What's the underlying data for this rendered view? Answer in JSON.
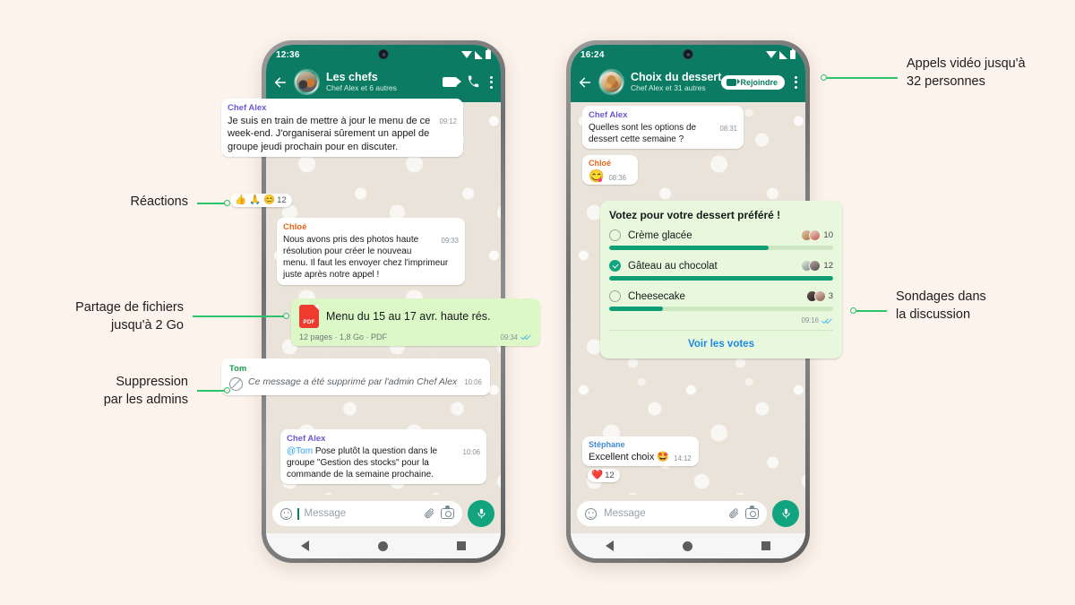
{
  "annotations": [
    {
      "id": "reactions",
      "text": "Réactions"
    },
    {
      "id": "filesharing",
      "text": "Partage de fichiers\njusqu'à 2 Go"
    },
    {
      "id": "admindelete",
      "text": "Suppression\npar les admins"
    },
    {
      "id": "videocalls",
      "text": "Appels vidéo jusqu'à\n32 personnes"
    },
    {
      "id": "polls",
      "text": "Sondages dans\nla discussion"
    }
  ],
  "annotation_lines": {
    "reactions_l1": "Réactions",
    "filesharing_l1": "Partage de fichiers",
    "filesharing_l2": "jusqu'à 2 Go",
    "admindelete_l1": "Suppression",
    "admindelete_l2": "par les admins",
    "videocalls_l1": "Appels vidéo jusqu'à",
    "videocalls_l2": "32 personnes",
    "polls_l1": "Sondages dans",
    "polls_l2": "la discussion"
  },
  "colors": {
    "page_background": "#FCF3EC",
    "whatsapp_green": "#0B7C63",
    "accent_green": "#12A37F",
    "leader_line": "#2CC36B",
    "outgoing_bubble": "#DCF8C6",
    "poll_bubble": "#E8F8DC",
    "link_blue": "#1E88E5",
    "mention_blue": "#2EA2F5",
    "pdf_red": "#EE3B2F"
  },
  "phone_left": {
    "status": {
      "clock": "12:36",
      "icons": [
        "wifi-icon",
        "signal-icon",
        "battery-icon"
      ]
    },
    "appbar": {
      "back_icon": "back-arrow-icon",
      "avatar": "group-avatar",
      "title": "Les chefs",
      "subtitle": "Chef Alex et 6 autres",
      "actions": [
        "video-call-icon",
        "voice-call-icon",
        "overflow-menu-icon"
      ]
    },
    "messages": [
      {
        "sender": "Chef Alex",
        "sender_color": "#6B57D6",
        "text": "Je suis en train de mettre à jour le menu de ce week-end. J'organiserai sûrement un appel de groupe jeudi prochain pour en discuter.",
        "time": "09:12",
        "reaction": {
          "emojis": "👍 🙏 😊",
          "count": "12"
        }
      },
      {
        "sender": "Chloé",
        "sender_color": "#E8651B",
        "text": "Nous avons pris des photos haute résolution pour créer le nouveau menu. Il faut les envoyer chez l'imprimeur juste après notre appel !",
        "time": "09:33"
      },
      {
        "type": "file",
        "file_icon": "pdf-file-icon",
        "file_badge": "PDF",
        "file_name": "Menu du 15 au 17 avr. haute rés.",
        "file_meta": "12 pages · 1,8 Go · PDF",
        "time": "09:34",
        "status_icon": "double-check-icon"
      },
      {
        "sender": "Tom",
        "sender_color": "#1A9E4B",
        "type": "deleted",
        "icon": "blocked-icon",
        "text": "Ce message a été supprimé par l'admin Chef Alex",
        "time": "10:06"
      },
      {
        "sender": "Chef Alex",
        "sender_color": "#6B57D6",
        "mention": "@Tom",
        "text": " Pose plutôt la question dans le groupe \"Gestion des stocks\" pour la commande de la semaine prochaine.",
        "time": "10:06"
      }
    ],
    "input": {
      "emoji_icon": "smiley-icon",
      "placeholder": "Message",
      "attach_icon": "paperclip-icon",
      "camera_icon": "camera-icon",
      "mic_icon": "microphone-icon"
    },
    "navbar": [
      "back-nav-icon",
      "home-nav-icon",
      "recents-nav-icon"
    ]
  },
  "phone_right": {
    "status": {
      "clock": "16:24",
      "icons": [
        "wifi-icon",
        "signal-icon",
        "battery-icon"
      ]
    },
    "appbar": {
      "back_icon": "back-arrow-icon",
      "avatar": "group-avatar",
      "title": "Choix du dessert",
      "subtitle": "Chef Alex et 31 autres",
      "join_button": "Rejoindre",
      "join_icon": "video-call-icon",
      "actions": [
        "overflow-menu-icon"
      ]
    },
    "messages": [
      {
        "sender": "Chef Alex",
        "sender_color": "#6B57D6",
        "text": "Quelles sont les options de dessert cette semaine ?",
        "time": "08:31"
      },
      {
        "sender": "Chloé",
        "sender_color": "#E8651B",
        "emoji": "😋",
        "time": "08:36"
      },
      {
        "sender": "Stéphane",
        "sender_color": "#3F8CD4",
        "text": "Excellent choix 🤩",
        "time": "14:12",
        "reaction": {
          "emojis": "❤️",
          "count": "12"
        }
      }
    ],
    "poll": {
      "title": "Votez pour votre dessert préféré !",
      "options": [
        {
          "label": "Crème glacée",
          "votes": "10",
          "selected": false,
          "percent": 71
        },
        {
          "label": "Gâteau au chocolat",
          "votes": "12",
          "selected": true,
          "percent": 100
        },
        {
          "label": "Cheesecake",
          "votes": "3",
          "selected": false,
          "percent": 24
        }
      ],
      "time": "09:16",
      "status_icon": "double-check-icon",
      "cta": "Voir les votes"
    },
    "input": {
      "emoji_icon": "smiley-icon",
      "placeholder": "Message",
      "attach_icon": "paperclip-icon",
      "camera_icon": "camera-icon",
      "mic_icon": "microphone-icon"
    },
    "navbar": [
      "back-nav-icon",
      "home-nav-icon",
      "recents-nav-icon"
    ]
  }
}
